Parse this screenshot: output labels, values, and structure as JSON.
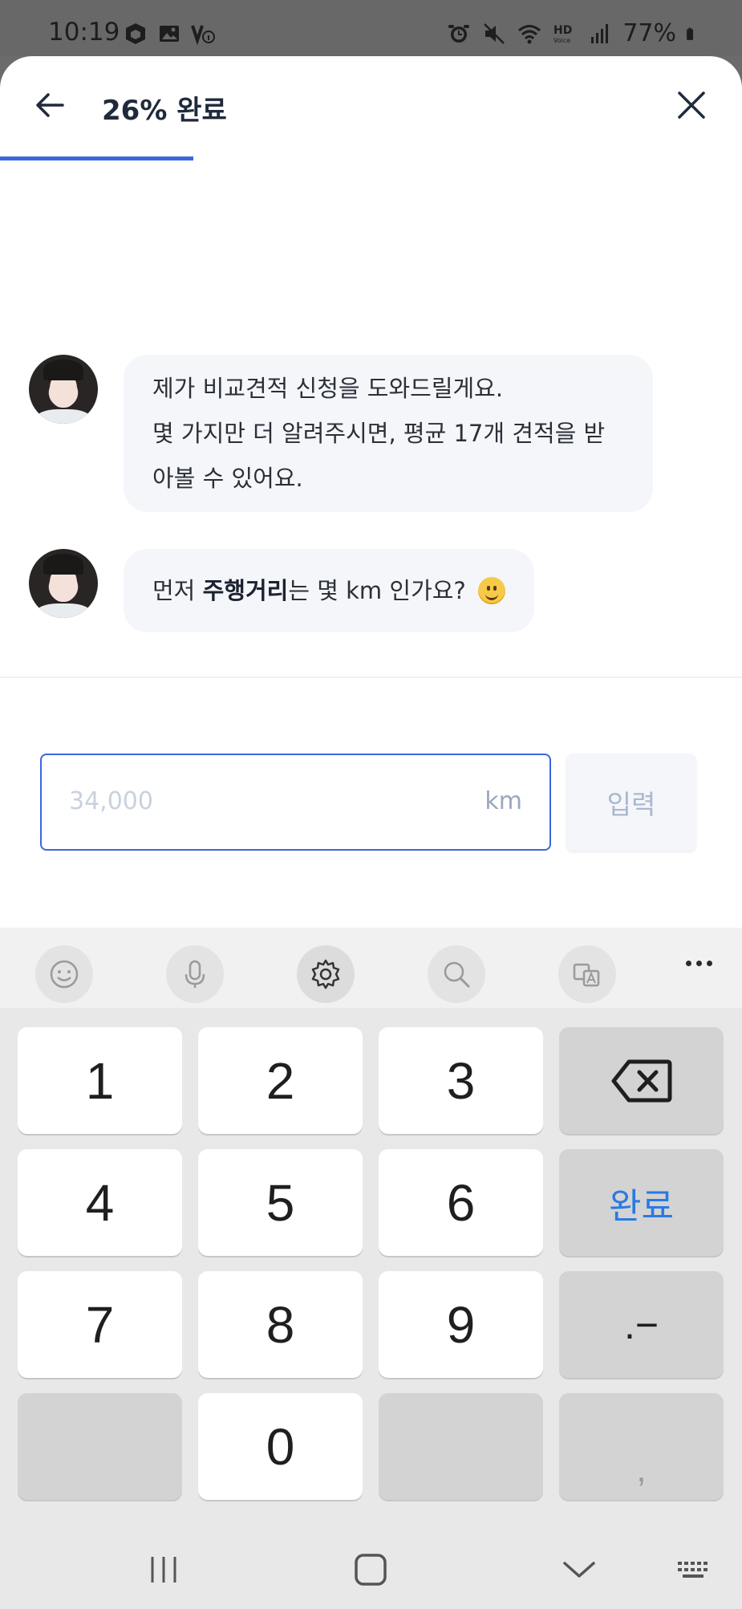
{
  "status_bar": {
    "time": "10:19",
    "battery_text": "77%",
    "icons_left": [
      "box-icon",
      "image-icon",
      "volte-icon"
    ],
    "icons_right": [
      "alarm-icon",
      "mute-icon",
      "wifi-icon",
      "hd-voice-icon",
      "signal-icon",
      "battery-icon"
    ]
  },
  "header": {
    "progress_label": "26% 완료",
    "progress_fraction": 0.26
  },
  "chat": {
    "messages": [
      {
        "lines": [
          "제가 비교견적 신청을 도와드릴게요.",
          "몇 가지만 더 알려주시면, 평균 17개 견적을 받",
          "아볼 수 있어요."
        ]
      },
      {
        "prefix": "먼저 ",
        "bold": "주행거리",
        "suffix": "는 몇 km 인가요?"
      }
    ]
  },
  "input": {
    "placeholder": "34,000",
    "unit": "km",
    "submit_label": "입력"
  },
  "keyboard": {
    "toolbar_icons": [
      "emoji-icon",
      "microphone-icon",
      "settings-icon",
      "search-icon",
      "translate-icon",
      "more-icon"
    ],
    "keys": {
      "k1": "1",
      "k2": "2",
      "k3": "3",
      "k4": "4",
      "k5": "5",
      "k6": "6",
      "k7": "7",
      "k8": "8",
      "k9": "9",
      "k0": "0",
      "done": "완료",
      "dot_dash": ".−",
      "comma": ","
    }
  },
  "nav_bar": {
    "icons": [
      "recents-icon",
      "home-icon",
      "back-chevron-icon",
      "keyboard-icon"
    ]
  }
}
